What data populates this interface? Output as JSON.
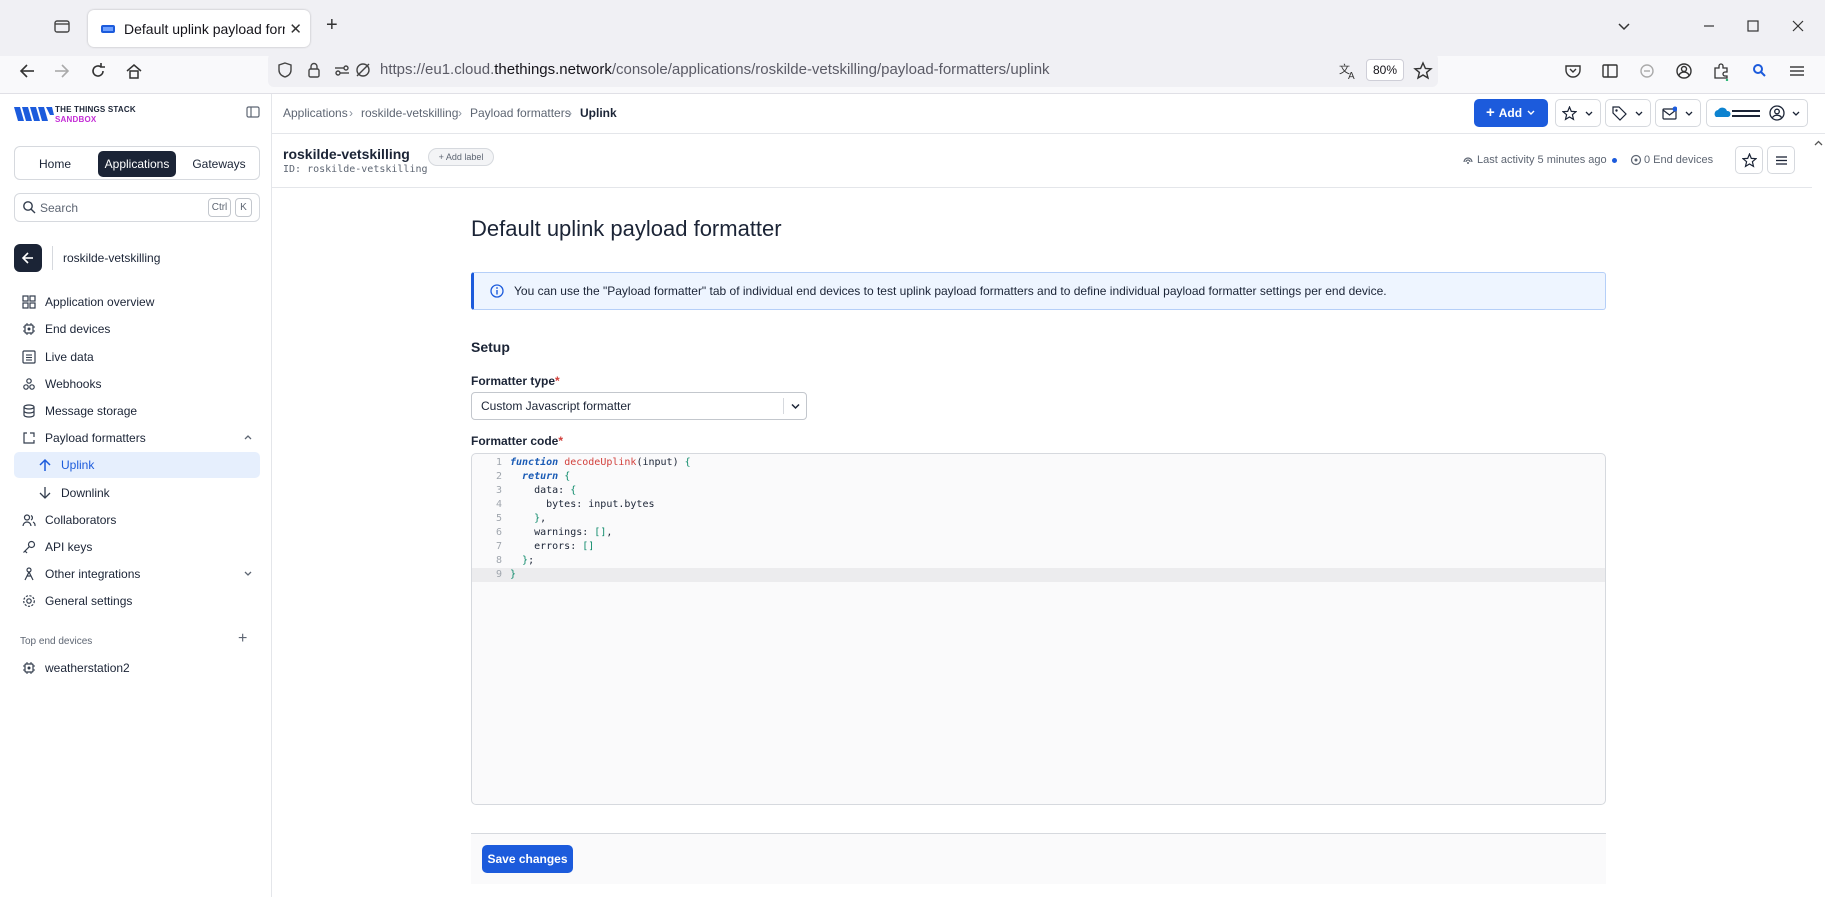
{
  "browser": {
    "tab_title": "Default uplink payload formatte",
    "url_prefix": "https://eu1.cloud.",
    "url_domain": "thethings.network",
    "url_path": "/console/applications/roskilde-vetskilling/payload-formatters/uplink",
    "zoom": "80%"
  },
  "sidebar": {
    "logo_line1": "THE THINGS STACK",
    "logo_line2": "SANDBOX",
    "tabs": [
      "Home",
      "Applications",
      "Gateways"
    ],
    "search_placeholder": "Search",
    "kbd_ctrl": "Ctrl",
    "kbd_k": "K",
    "app_name": "roskilde-vetskilling",
    "items": [
      {
        "label": "Application overview",
        "icon": "grid-icon"
      },
      {
        "label": "End devices",
        "icon": "chip-icon"
      },
      {
        "label": "Live data",
        "icon": "list-icon"
      },
      {
        "label": "Webhooks",
        "icon": "webhook-icon"
      },
      {
        "label": "Message storage",
        "icon": "database-icon"
      },
      {
        "label": "Payload formatters",
        "icon": "code-icon"
      },
      {
        "label": "Uplink",
        "icon": "arrow-up-icon"
      },
      {
        "label": "Downlink",
        "icon": "arrow-down-icon"
      },
      {
        "label": "Collaborators",
        "icon": "users-icon"
      },
      {
        "label": "API keys",
        "icon": "key-icon"
      },
      {
        "label": "Other integrations",
        "icon": "integrations-icon"
      },
      {
        "label": "General settings",
        "icon": "gear-icon"
      }
    ],
    "top_devices_title": "Top end devices",
    "top_devices": [
      "weatherstation2"
    ]
  },
  "header": {
    "breadcrumbs": [
      "Applications",
      "roskilde-vetskilling",
      "Payload formatters",
      "Uplink"
    ],
    "add_label": "Add"
  },
  "appbar": {
    "title": "roskilde-vetskilling",
    "id_label": "ID:",
    "id_value": "roskilde-vetskilling",
    "add_label": "Add label",
    "last_activity": "Last activity 5 minutes ago",
    "end_devices": "0 End devices"
  },
  "main": {
    "title": "Default uplink payload formatter",
    "info": "You can use the \"Payload formatter\" tab of individual end devices to test uplink payload formatters and to define individual payload formatter settings per end device.",
    "setup_heading": "Setup",
    "formatter_type_label": "Formatter type",
    "formatter_type_value": "Custom Javascript formatter",
    "formatter_code_label": "Formatter code",
    "required_mark": "*",
    "save_label": "Save changes",
    "code_lines": [
      "function decodeUplink(input) {",
      "  return {",
      "    data: {",
      "      bytes: input.bytes",
      "    },",
      "    warnings: [],",
      "    errors: []",
      "  };",
      "}"
    ]
  },
  "colors": {
    "accent": "#1c5bdc",
    "sidebar_active_bg": "#e6effd",
    "dark": "#1b2436"
  }
}
